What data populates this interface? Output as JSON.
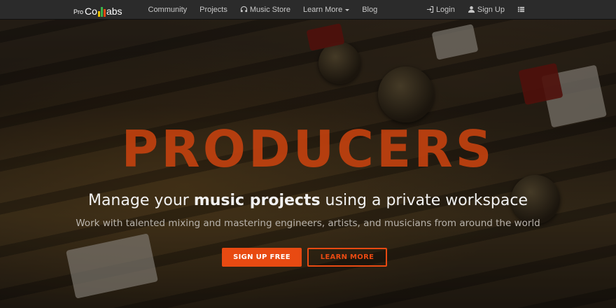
{
  "brand": {
    "pre": "Pro",
    "mid": "Co",
    "post": "abs",
    "bar_colors": [
      "#e8c200",
      "#3bb24a",
      "#e84a12"
    ]
  },
  "nav": {
    "links": [
      {
        "label": "Community"
      },
      {
        "label": "Projects"
      },
      {
        "label": "Music Store",
        "icon": "headphones-icon"
      },
      {
        "label": "Learn More",
        "dropdown": true
      },
      {
        "label": "Blog"
      }
    ],
    "right": [
      {
        "label": "Login",
        "icon": "login-icon"
      },
      {
        "label": "Sign Up",
        "icon": "user-icon"
      },
      {
        "label": "",
        "icon": "list-menu-icon"
      }
    ]
  },
  "hero": {
    "title": "PRODUCERS",
    "tagline_pre": "Manage your ",
    "tagline_bold": "music projects",
    "tagline_post": " using a private workspace",
    "subline": "Work with talented mixing and mastering engineers, artists, and musicians from around the world",
    "primary_button": "SIGN UP FREE",
    "secondary_button": "LEARN MORE"
  },
  "colors": {
    "accent": "#e84a12",
    "title": "#c1410f",
    "nav_bg": "#2b2b2b"
  }
}
